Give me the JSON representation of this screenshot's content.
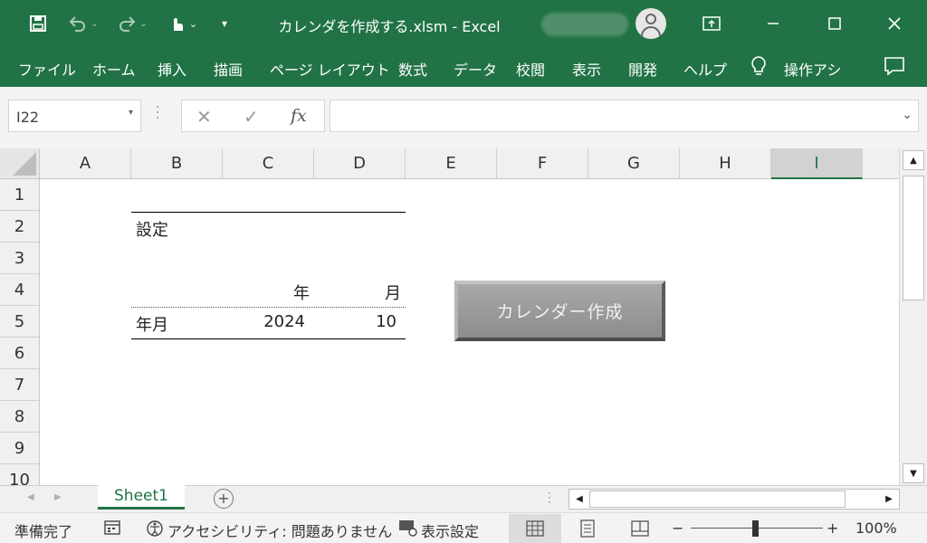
{
  "app": {
    "title": "カレンダを作成する.xlsm  -  Excel",
    "accent_color": "#217346"
  },
  "quick_access": {
    "icons": [
      "save-icon",
      "undo-icon",
      "redo-icon",
      "touch-mode-icon",
      "customize-icon"
    ]
  },
  "window_controls": {
    "icons": [
      "ribbon-display-icon",
      "minimize-icon",
      "maximize-icon",
      "close-icon"
    ]
  },
  "ribbon": {
    "tabs": [
      {
        "label": "ファイル"
      },
      {
        "label": "ホーム"
      },
      {
        "label": "挿入"
      },
      {
        "label": "描画"
      },
      {
        "label": "ページ レイアウト"
      },
      {
        "label": "数式"
      },
      {
        "label": "データ"
      },
      {
        "label": "校閲"
      },
      {
        "label": "表示"
      },
      {
        "label": "開発"
      },
      {
        "label": "ヘルプ"
      }
    ],
    "tell_me": "操作アシ",
    "comments_icon": "comment-icon"
  },
  "formula_bar": {
    "name_box": "I22",
    "fx_label": "fx",
    "formula_value": ""
  },
  "grid": {
    "columns": [
      "A",
      "B",
      "C",
      "D",
      "E",
      "F",
      "G",
      "H",
      "I"
    ],
    "selected_column": "I",
    "rows": [
      "1",
      "2",
      "3",
      "4",
      "5",
      "6",
      "7",
      "8",
      "9",
      "10"
    ],
    "cells": {
      "B2": "設定",
      "C4": "年",
      "D4": "月",
      "B5": "年月",
      "C5": "2024",
      "D5": "10"
    }
  },
  "button": {
    "label": "カレンダー作成"
  },
  "sheets": {
    "tabs": [
      "Sheet1"
    ],
    "active": "Sheet1",
    "add_label": "+"
  },
  "status": {
    "ready": "準備完了",
    "accessibility": "アクセシビリティ: 問題ありません",
    "display_settings": "表示設定",
    "zoom_minus": "−",
    "zoom_plus": "+",
    "zoom": "100%",
    "zoom_level_percent": 100
  }
}
